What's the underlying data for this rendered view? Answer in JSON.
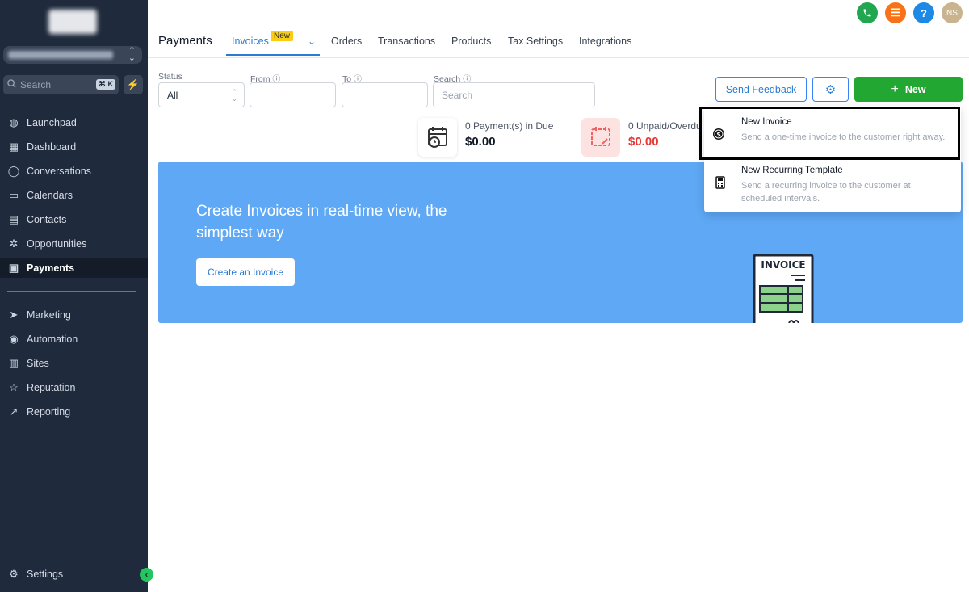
{
  "sidebar": {
    "search_placeholder": "Search",
    "search_shortcut": "⌘ K",
    "items": [
      {
        "label": "Launchpad",
        "icon": "launchpad-icon"
      },
      {
        "label": "Dashboard",
        "icon": "dashboard-icon"
      },
      {
        "label": "Conversations",
        "icon": "chat-icon"
      },
      {
        "label": "Calendars",
        "icon": "calendar-icon"
      },
      {
        "label": "Contacts",
        "icon": "contacts-icon"
      },
      {
        "label": "Opportunities",
        "icon": "opportunities-icon"
      },
      {
        "label": "Payments",
        "icon": "payments-icon"
      },
      {
        "label": "Marketing",
        "icon": "send-icon"
      },
      {
        "label": "Automation",
        "icon": "automation-icon"
      },
      {
        "label": "Sites",
        "icon": "sites-icon"
      },
      {
        "label": "Reputation",
        "icon": "star-icon"
      },
      {
        "label": "Reporting",
        "icon": "trend-icon"
      }
    ],
    "settings_label": "Settings"
  },
  "header": {
    "title": "Payments",
    "tabs": [
      "Invoices",
      "Orders",
      "Transactions",
      "Products",
      "Tax Settings",
      "Integrations"
    ],
    "new_badge": "New",
    "avatar_initials": "NS"
  },
  "filters": {
    "status_label": "Status",
    "status_value": "All",
    "from_label": "From",
    "to_label": "To",
    "search_label": "Search",
    "search_placeholder": "Search"
  },
  "actions": {
    "feedback_label": "Send Feedback",
    "new_label": "New"
  },
  "stats": [
    {
      "count_text": "0  Payment(s) in Due",
      "amount": "$0.00"
    },
    {
      "count_text": "0  Unpaid/Overdu",
      "amount": "$0.00"
    }
  ],
  "banner": {
    "title": "Create Invoices in real-time view, the simplest way",
    "button_label": "Create an Invoice",
    "illustration_label": "INVOICE"
  },
  "dropdown": {
    "items": [
      {
        "title": "New Invoice",
        "desc": "Send a one-time invoice to the customer right away."
      },
      {
        "title": "New Recurring Template",
        "desc": "Send a recurring invoice to the customer at scheduled intervals."
      }
    ]
  },
  "colors": {
    "sidebar_bg": "#1f2a3c",
    "accent_blue": "#2b7bd4",
    "accent_green": "#22a732",
    "banner_bg": "#5ea8f5",
    "overdue_red": "#e53935"
  }
}
